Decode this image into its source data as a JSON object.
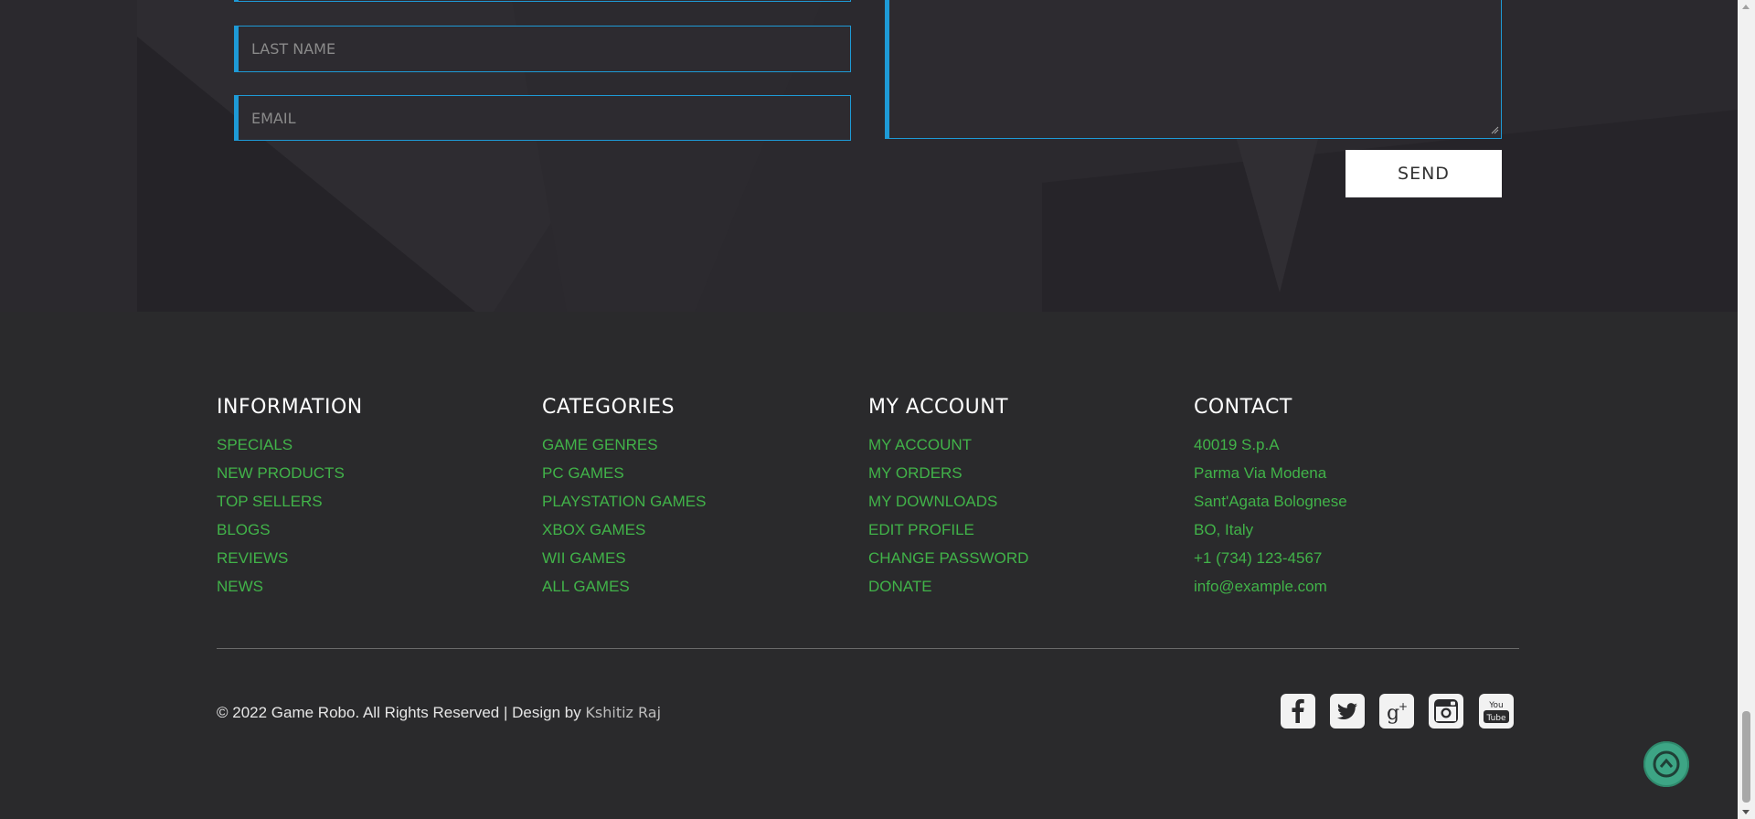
{
  "contact_form": {
    "last_name_placeholder": "LAST NAME",
    "email_placeholder": "EMAIL",
    "send_label": "SEND"
  },
  "footer": {
    "information": {
      "heading": "INFORMATION",
      "items": [
        "SPECIALS",
        "NEW PRODUCTS",
        "TOP SELLERS",
        "BLOGS",
        "REVIEWS",
        "NEWS"
      ]
    },
    "categories": {
      "heading": "CATEGORIES",
      "items": [
        "GAME GENRES",
        "PC GAMES",
        "PLAYSTATION GAMES",
        "XBOX GAMES",
        "WII GAMES",
        "ALL GAMES"
      ]
    },
    "my_account": {
      "heading": "MY ACCOUNT",
      "items": [
        "MY ACCOUNT",
        "MY ORDERS",
        "MY DOWNLOADS",
        "EDIT PROFILE",
        "CHANGE PASSWORD",
        "DONATE"
      ]
    },
    "contact": {
      "heading": "CONTACT",
      "items": [
        "40019 S.p.A",
        "Parma Via Modena",
        "Sant'Agata Bolognese",
        "BO, Italy",
        "+1 (734) 123-4567",
        "info@example.com"
      ]
    },
    "copyright_text": "© 2022 Game Robo. All Rights Reserved | Design by ",
    "designer": "Kshitiz Raj",
    "social_icons": [
      "facebook-icon",
      "twitter-icon",
      "google-plus-icon",
      "instagram-icon",
      "youtube-icon"
    ]
  },
  "colors": {
    "accent": "#1e9ad6",
    "link_green": "#41b349",
    "background": "#2a2a2c",
    "back_to_top": "#3da585"
  }
}
